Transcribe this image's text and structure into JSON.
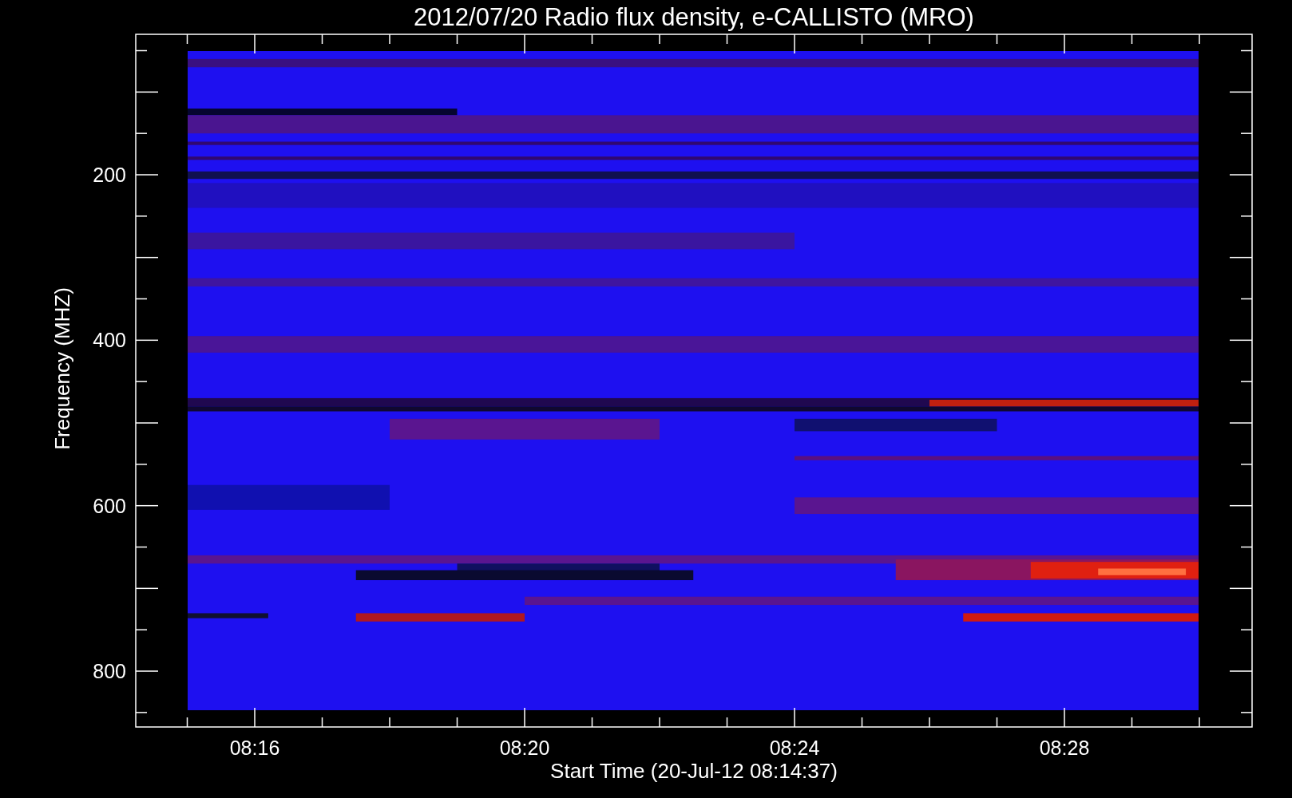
{
  "title": "2012/07/20  Radio flux density, e-CALLISTO (MRO)",
  "y_axis": {
    "label": "Frequency (MHZ)",
    "ticks": [
      "200",
      "400",
      "600",
      "800"
    ]
  },
  "x_axis": {
    "label": "Start Time (20-Jul-12 08:14:37)",
    "ticks": [
      "08:16",
      "08:20",
      "08:24",
      "08:28"
    ]
  }
}
